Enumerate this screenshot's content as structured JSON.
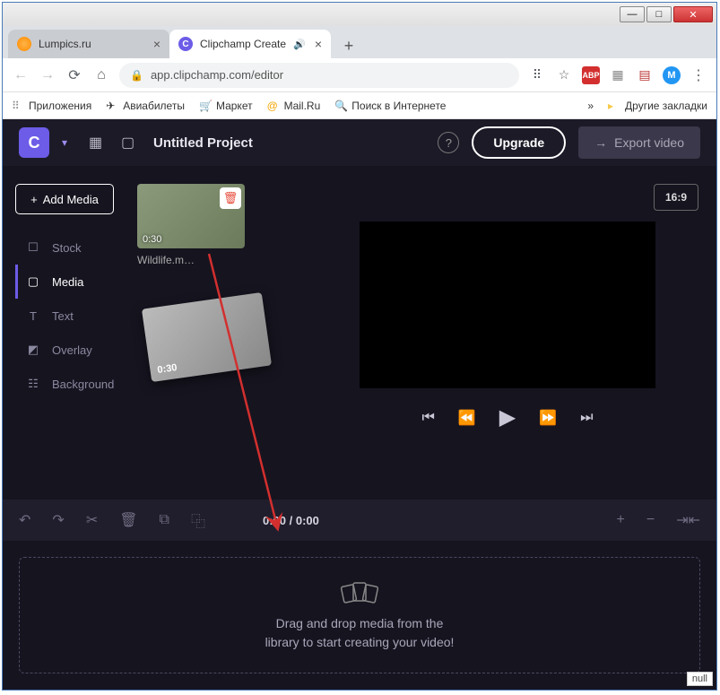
{
  "window": {
    "min": "—",
    "max": "□",
    "close": "✕"
  },
  "tabs": {
    "t1": "Lumpics.ru",
    "t2": "Clipchamp Create"
  },
  "url": "app.clipchamp.com/editor",
  "bookmarks": {
    "apps": "Приложения",
    "avia": "Авиабилеты",
    "market": "Маркет",
    "mail": "Mail.Ru",
    "search": "Поиск в Интернете",
    "other": "Другие закладки"
  },
  "header": {
    "logo": "C",
    "title": "Untitled Project",
    "upgrade": "Upgrade",
    "export": "Export video"
  },
  "sidebar": {
    "add": "Add Media",
    "items": [
      {
        "label": "Stock"
      },
      {
        "label": "Media"
      },
      {
        "label": "Text"
      },
      {
        "label": "Overlay"
      },
      {
        "label": "Background"
      }
    ]
  },
  "media": {
    "thumb_duration": "0:30",
    "thumb_name": "Wildlife.m…",
    "drag_duration": "0:30"
  },
  "preview": {
    "aspect": "16:9",
    "time": "0:00 / 0:00"
  },
  "dropzone": {
    "line1": "Drag and drop media from the",
    "line2": "library to start creating your video!"
  },
  "null_badge": "null"
}
